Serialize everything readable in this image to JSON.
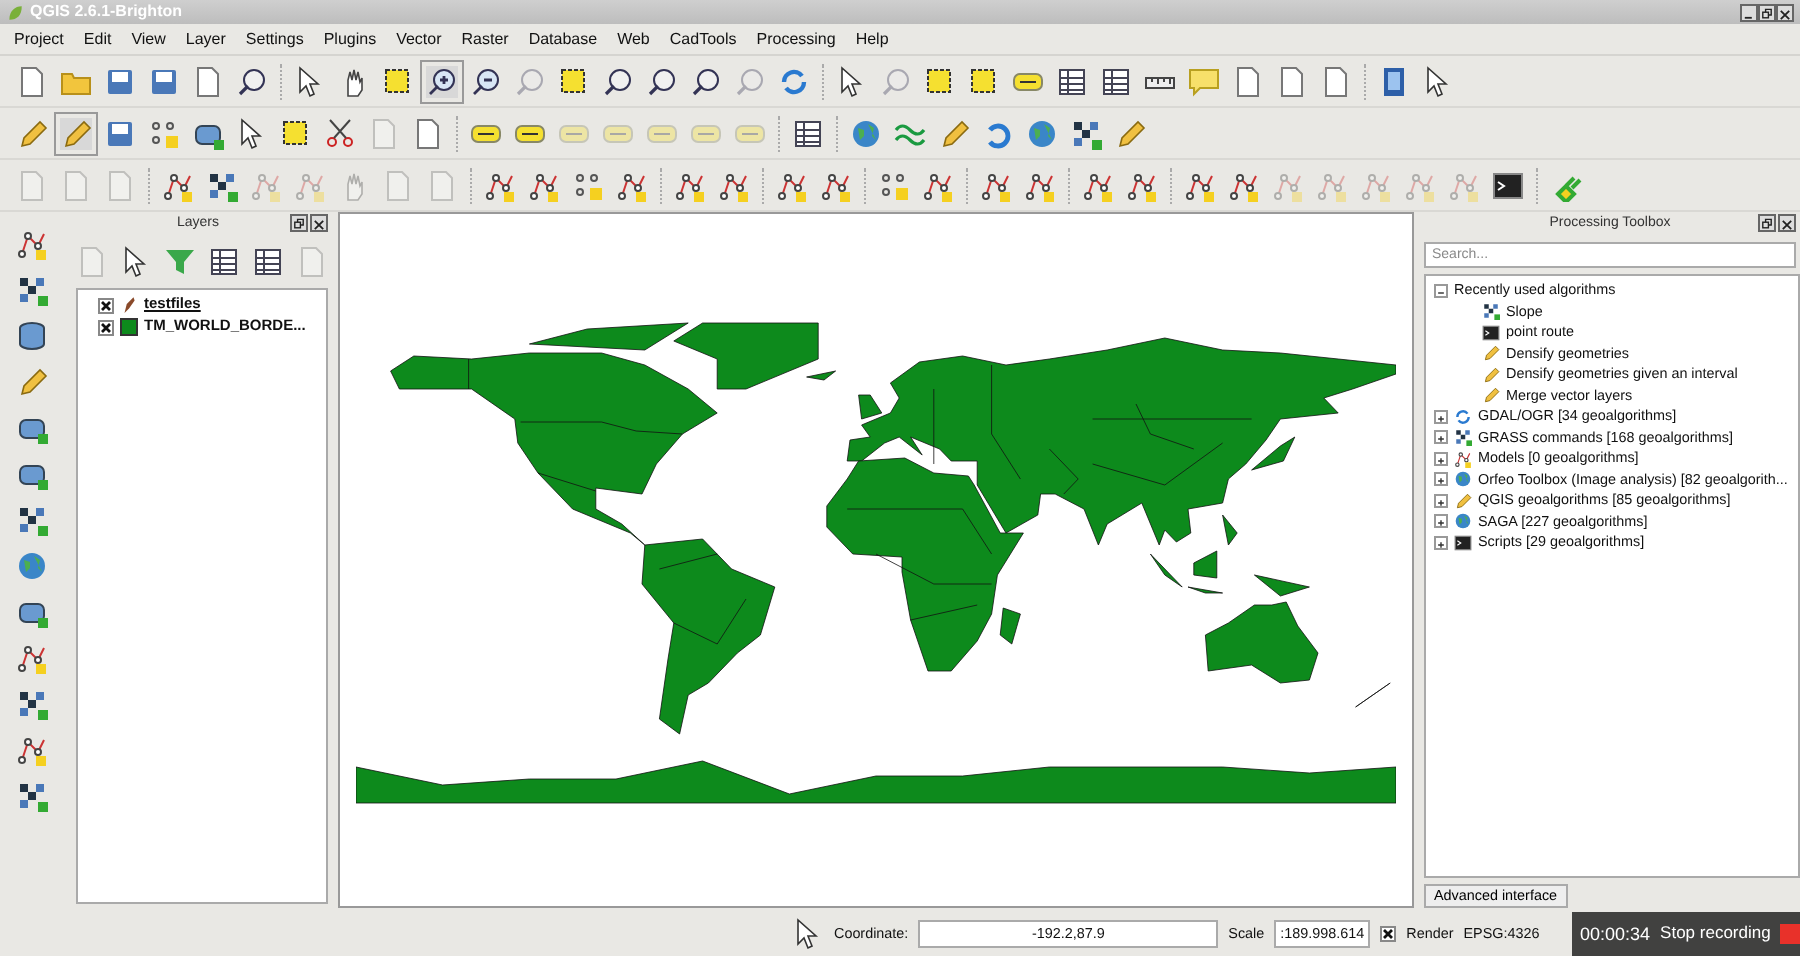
{
  "window": {
    "title": "QGIS 2.6.1-Brighton"
  },
  "menu": [
    "Project",
    "Edit",
    "View",
    "Layer",
    "Settings",
    "Plugins",
    "Vector",
    "Raster",
    "Database",
    "Web",
    "CadTools",
    "Processing",
    "Help"
  ],
  "layers_panel": {
    "title": "Layers",
    "layers": [
      {
        "kind": "group",
        "name": "testfiles",
        "checked": true
      },
      {
        "kind": "layer",
        "name": "TM_WORLD_BORDE...",
        "checked": true,
        "color": "#0d8a1c"
      }
    ]
  },
  "processing_toolbox": {
    "title": "Processing Toolbox",
    "search": {
      "placeholder": "Search..."
    },
    "tree": [
      {
        "label": "Recently used algorithms",
        "expanded": true,
        "children": [
          {
            "label": "Slope"
          },
          {
            "label": "point route"
          },
          {
            "label": "Densify geometries"
          },
          {
            "label": "Densify geometries given an interval"
          },
          {
            "label": "Merge vector layers"
          }
        ]
      },
      {
        "label": "GDAL/OGR [34 geoalgorithms]",
        "expanded": false
      },
      {
        "label": "GRASS commands [168 geoalgorithms]",
        "expanded": false
      },
      {
        "label": "Models [0 geoalgorithms]",
        "expanded": false
      },
      {
        "label": "Orfeo Toolbox (Image analysis) [82 geoalgorith...",
        "expanded": false
      },
      {
        "label": "QGIS geoalgorithms [85 geoalgorithms]",
        "expanded": false
      },
      {
        "label": "SAGA [227 geoalgorithms]",
        "expanded": false
      },
      {
        "label": "Scripts [29 geoalgorithms]",
        "expanded": false
      }
    ],
    "mode_button": "Advanced interface"
  },
  "status_bar": {
    "coordinate_label": "Coordinate:",
    "coordinate": "-192.2,87.9",
    "scale_label": "Scale",
    "scale": ":189.998.614",
    "render": {
      "label": "Render",
      "checked": true
    },
    "crs": "EPSG:4326"
  },
  "recording_overlay": {
    "time": "00:00:34",
    "button": "Stop recording"
  }
}
